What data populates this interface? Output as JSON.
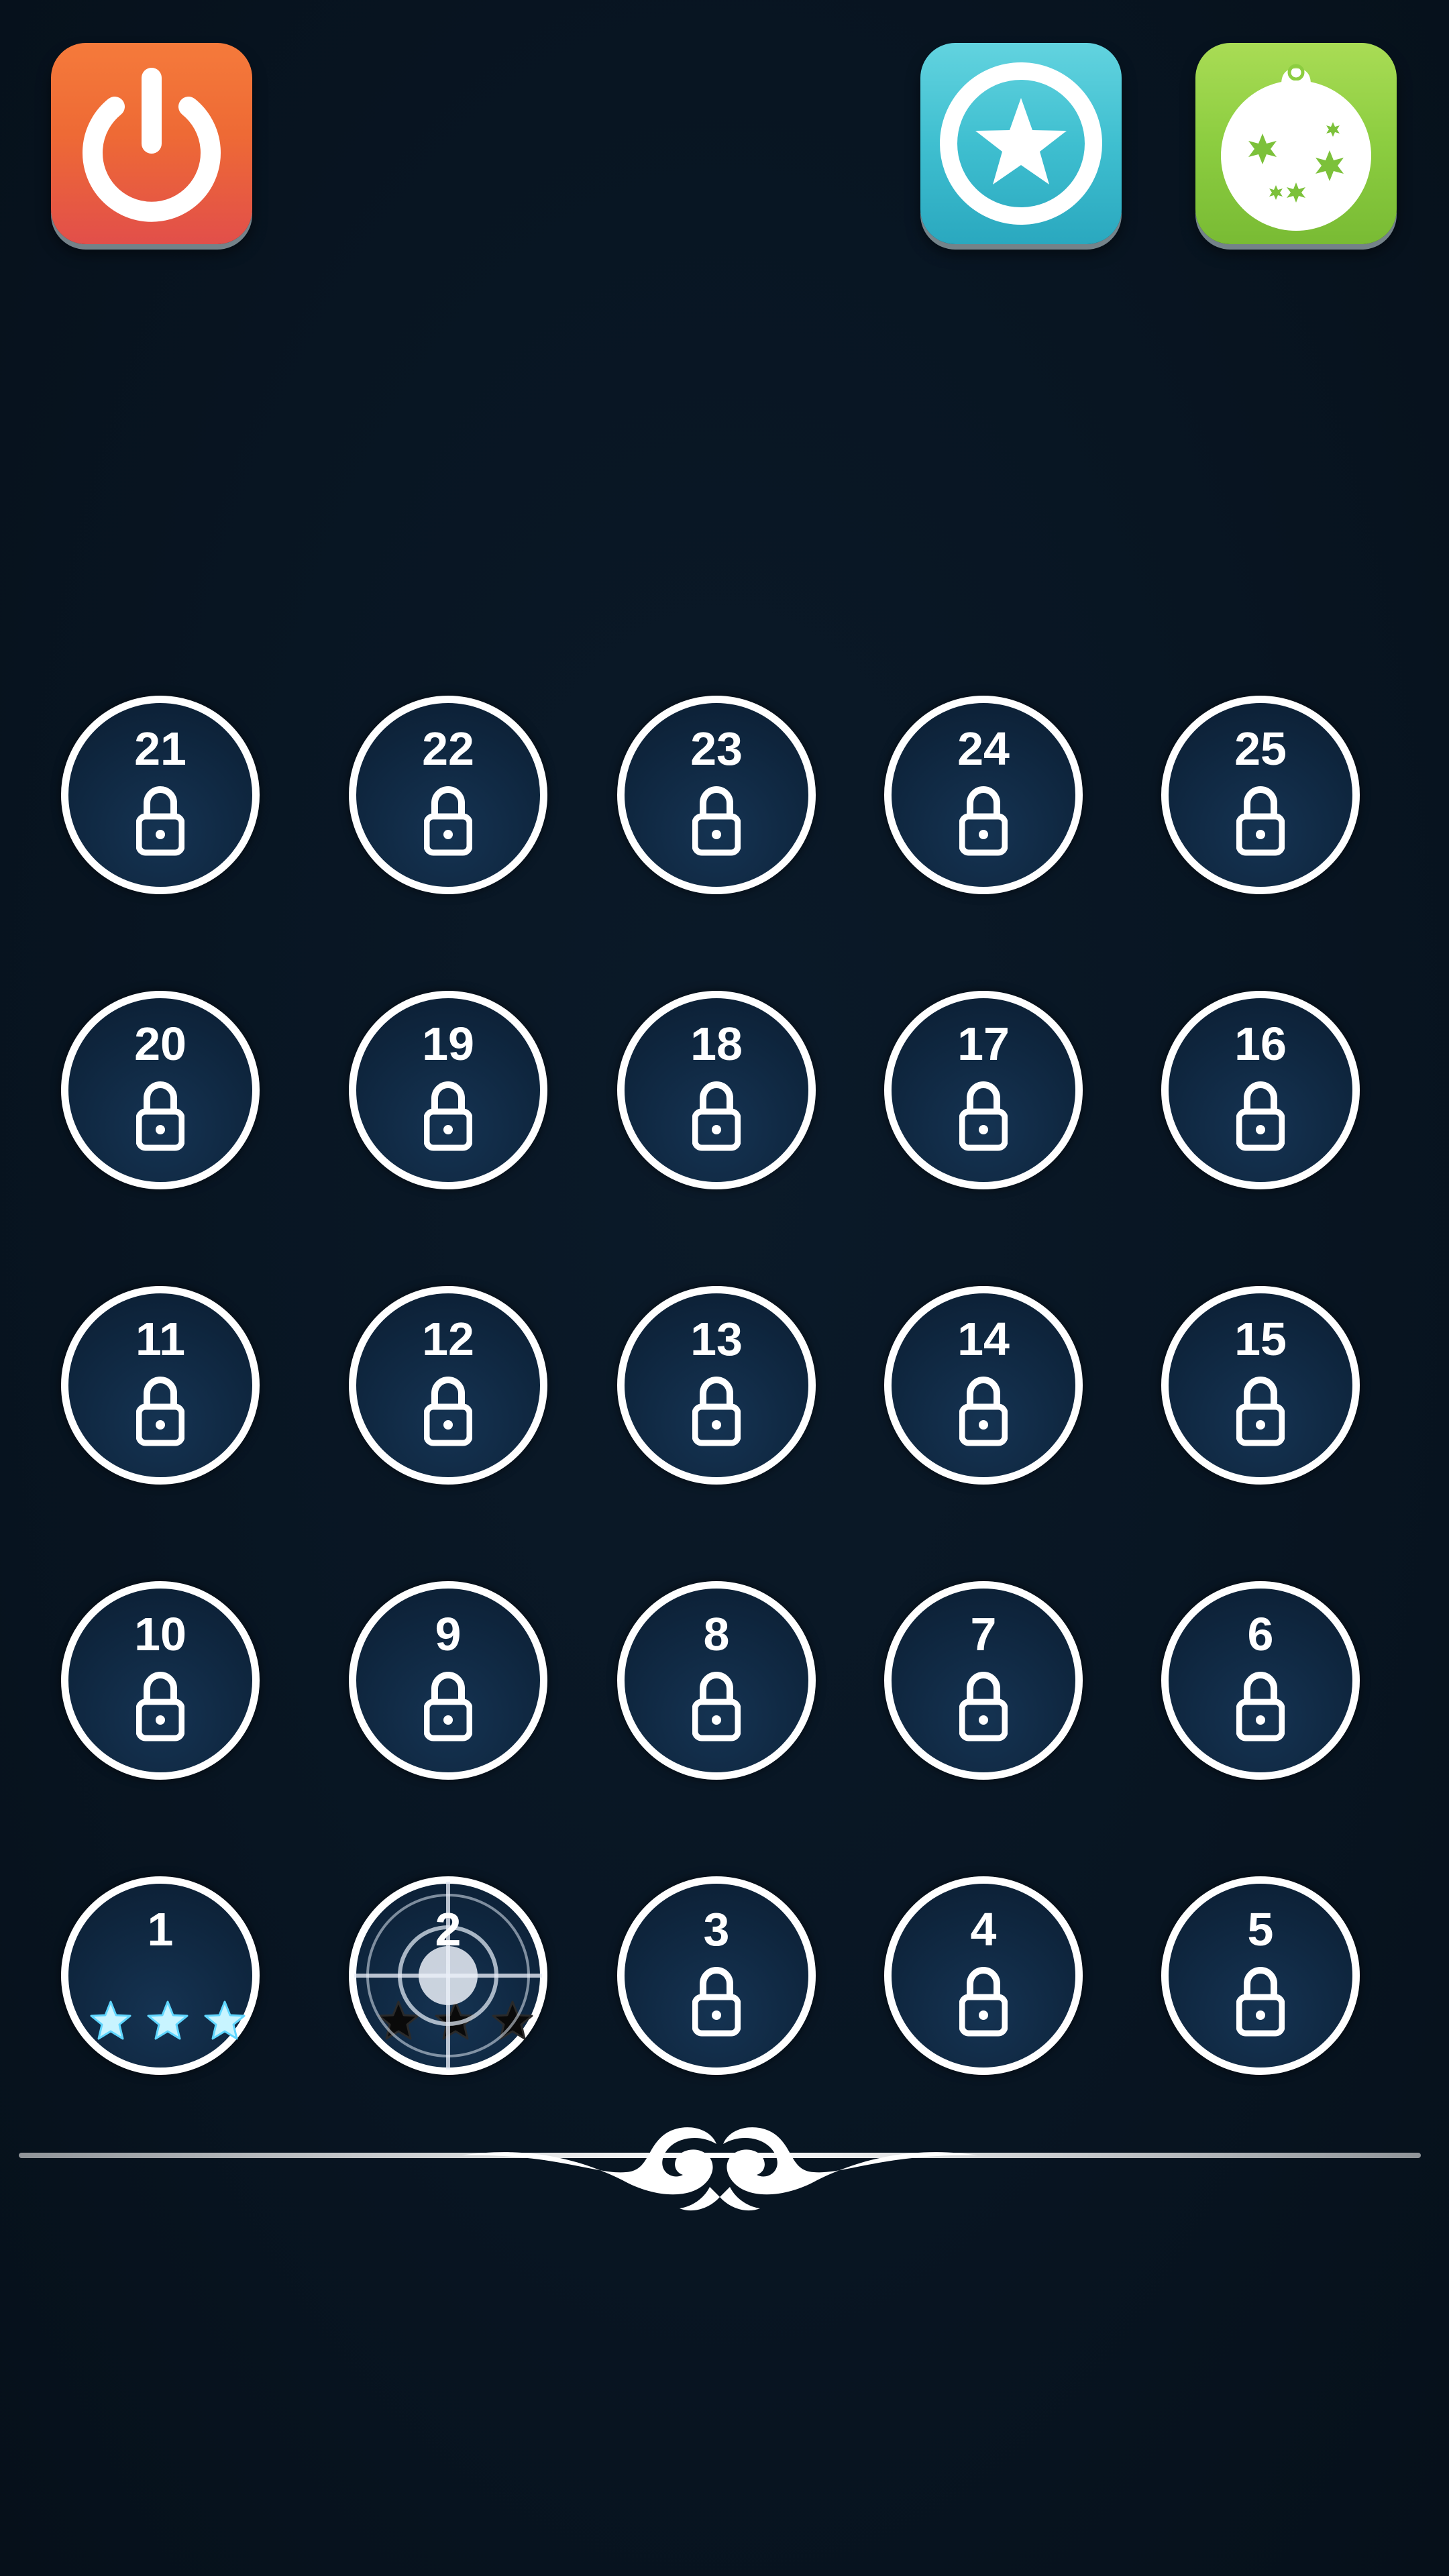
{
  "top_buttons": {
    "power": {
      "icon": "power-icon",
      "color": "#ee6a35"
    },
    "rate": {
      "icon": "star-icon",
      "color": "#3fbfd0"
    },
    "gift": {
      "icon": "ornament-icon",
      "color": "#8ccd40"
    }
  },
  "level_rows": [
    [
      {
        "num": "21",
        "state": "locked"
      },
      {
        "num": "22",
        "state": "locked"
      },
      {
        "num": "23",
        "state": "locked"
      },
      {
        "num": "24",
        "state": "locked"
      },
      {
        "num": "25",
        "state": "locked"
      }
    ],
    [
      {
        "num": "20",
        "state": "locked"
      },
      {
        "num": "19",
        "state": "locked"
      },
      {
        "num": "18",
        "state": "locked"
      },
      {
        "num": "17",
        "state": "locked"
      },
      {
        "num": "16",
        "state": "locked"
      }
    ],
    [
      {
        "num": "11",
        "state": "locked"
      },
      {
        "num": "12",
        "state": "locked"
      },
      {
        "num": "13",
        "state": "locked"
      },
      {
        "num": "14",
        "state": "locked"
      },
      {
        "num": "15",
        "state": "locked"
      }
    ],
    [
      {
        "num": "10",
        "state": "locked"
      },
      {
        "num": "9",
        "state": "locked"
      },
      {
        "num": "8",
        "state": "locked"
      },
      {
        "num": "7",
        "state": "locked"
      },
      {
        "num": "6",
        "state": "locked"
      }
    ],
    [
      {
        "num": "1",
        "state": "completed",
        "stars_earned": 3,
        "stars_total": 3
      },
      {
        "num": "2",
        "state": "current",
        "stars_earned": 0,
        "stars_total": 3
      },
      {
        "num": "3",
        "state": "locked"
      },
      {
        "num": "4",
        "state": "locked"
      },
      {
        "num": "5",
        "state": "locked"
      }
    ]
  ],
  "colors": {
    "background": "#07121d",
    "level_fill": "#0f2740",
    "level_ring": "#ffffff",
    "star_earned": "#c8f4ff",
    "star_empty": "#0a0a0a"
  }
}
